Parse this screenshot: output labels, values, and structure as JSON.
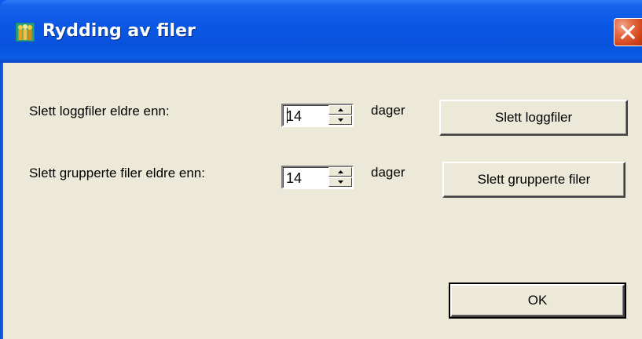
{
  "window": {
    "title": "Rydding av filer"
  },
  "rows": [
    {
      "label": "Slett loggfiler eldre enn:",
      "value": "14",
      "unit": "dager",
      "button_label": "Slett loggfiler"
    },
    {
      "label": "Slett grupperte filer eldre enn:",
      "value": "14",
      "unit": "dager",
      "button_label": "Slett grupperte filer"
    }
  ],
  "ok_label": "OK",
  "icons": {
    "app": "people-icon",
    "close": "close-x-icon",
    "spin_up": "arrow-up-icon",
    "spin_down": "arrow-down-icon"
  },
  "colors": {
    "titlebar": "#0a52dc",
    "client": "#ece9d8",
    "close": "#cf4117"
  }
}
